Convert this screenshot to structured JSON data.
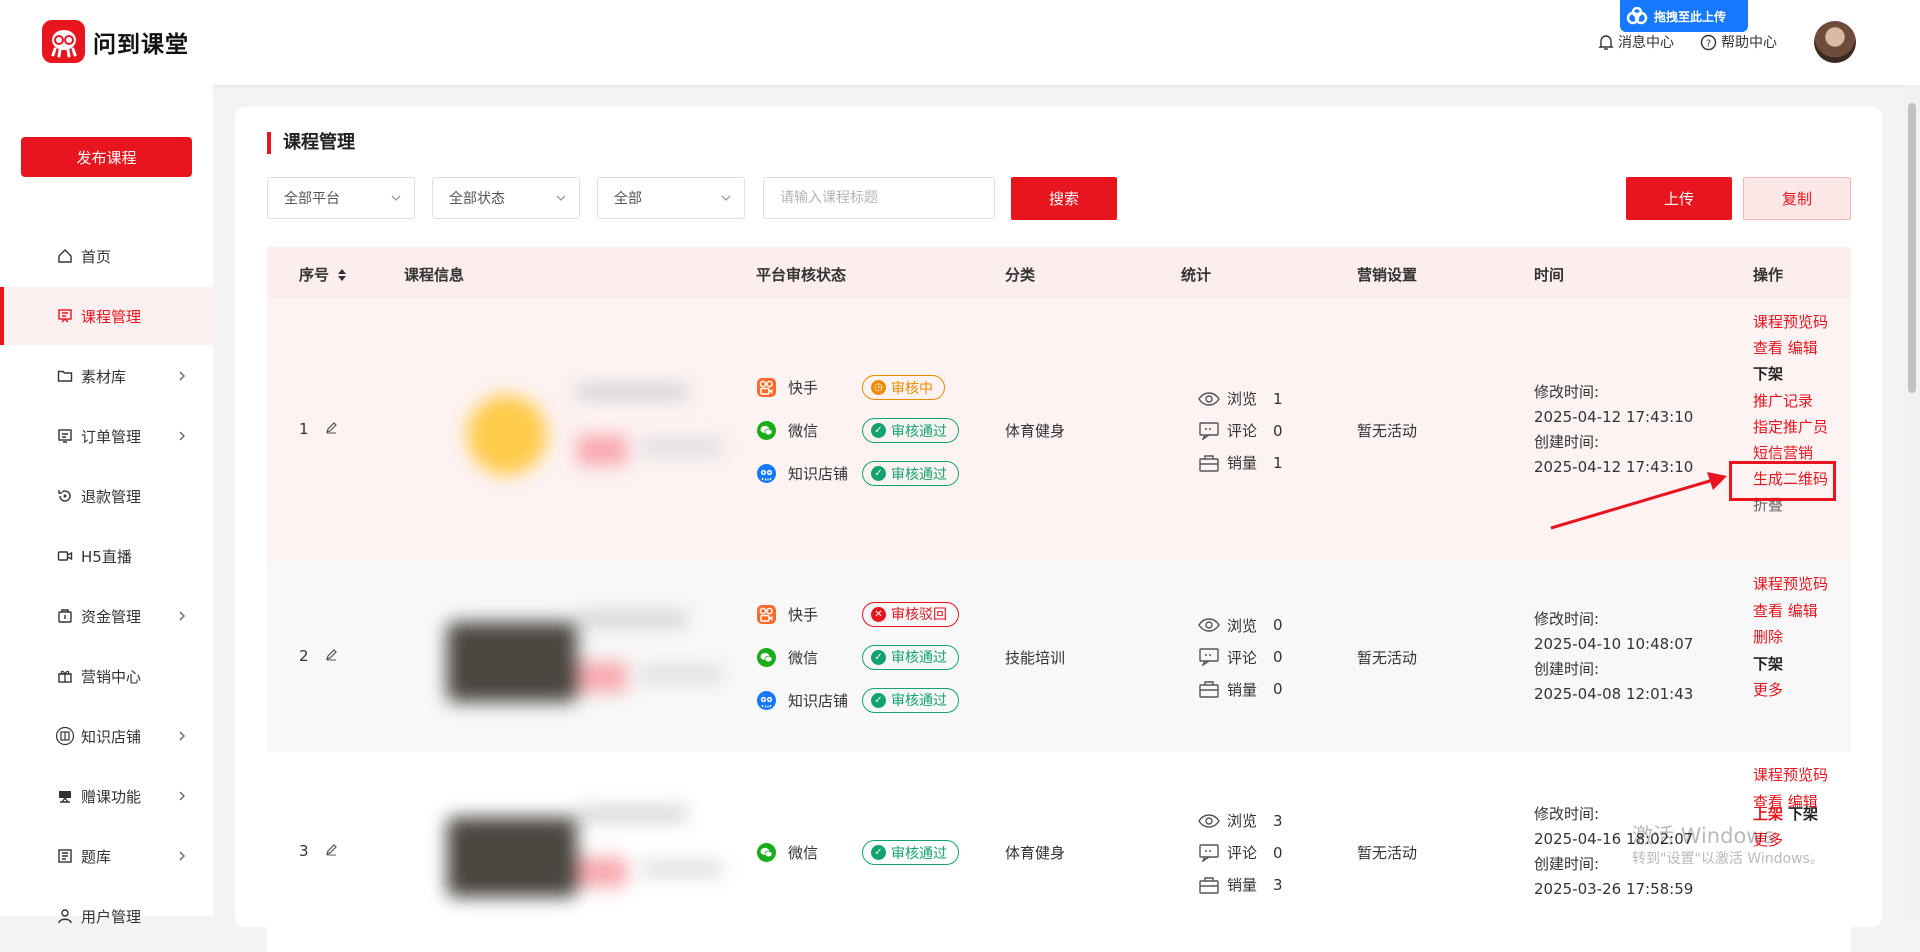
{
  "header": {
    "logo_text": "问到课堂",
    "drop_upload_label": "拖拽至此上传",
    "messages_label": "消息中心",
    "help_label": "帮助中心"
  },
  "sidebar": {
    "publish_label": "发布课程",
    "items": [
      {
        "label": "首页",
        "icon": "home-icon",
        "has_arrow": false
      },
      {
        "label": "课程管理",
        "icon": "course-icon",
        "has_arrow": false,
        "active": true
      },
      {
        "label": "素材库",
        "icon": "folder-icon",
        "has_arrow": true
      },
      {
        "label": "订单管理",
        "icon": "order-icon",
        "has_arrow": true
      },
      {
        "label": "退款管理",
        "icon": "refund-icon",
        "has_arrow": false
      },
      {
        "label": "H5直播",
        "icon": "video-icon",
        "has_arrow": false
      },
      {
        "label": "资金管理",
        "icon": "wallet-icon",
        "has_arrow": true
      },
      {
        "label": "营销中心",
        "icon": "gift-icon",
        "has_arrow": false
      },
      {
        "label": "知识店铺",
        "icon": "shop-icon",
        "has_arrow": true
      },
      {
        "label": "赠课功能",
        "icon": "gift-course-icon",
        "has_arrow": true
      },
      {
        "label": "题库",
        "icon": "question-bank-icon",
        "has_arrow": true
      },
      {
        "label": "用户管理",
        "icon": "user-icon",
        "has_arrow": false
      }
    ]
  },
  "main": {
    "title": "课程管理",
    "filters": {
      "platform": "全部平台",
      "status": "全部状态",
      "category": "全部",
      "search_placeholder": "请输入课程标题",
      "search_label": "搜索",
      "upload_label": "上传",
      "copy_label": "复制"
    },
    "columns": [
      "序号",
      "课程信息",
      "平台审核状态",
      "分类",
      "统计",
      "营销设置",
      "时间",
      "操作"
    ],
    "stat_labels": {
      "views": "浏览",
      "comments": "评论",
      "sales": "销量"
    },
    "time_labels": {
      "modified": "修改时间:",
      "created": "创建时间:"
    },
    "rows": [
      {
        "seq": "1",
        "platforms": [
          {
            "name": "快手",
            "status": "审核中"
          },
          {
            "name": "微信",
            "status": "审核通过"
          },
          {
            "name": "知识店铺",
            "status": "审核通过"
          }
        ],
        "category": "体育健身",
        "views": "1",
        "comments": "0",
        "sales": "1",
        "marketing": "暂无活动",
        "modified": "2025-04-12 17:43:10",
        "created": "2025-04-12 17:43:10",
        "ops": [
          "课程预览码",
          "查看 编辑",
          "下架",
          "推广记录",
          "指定推广员",
          "短信营销",
          "生成二维码",
          "折叠"
        ]
      },
      {
        "seq": "2",
        "platforms": [
          {
            "name": "快手",
            "status": "审核驳回"
          },
          {
            "name": "微信",
            "status": "审核通过"
          },
          {
            "name": "知识店铺",
            "status": "审核通过"
          }
        ],
        "category": "技能培训",
        "views": "0",
        "comments": "0",
        "sales": "0",
        "marketing": "暂无活动",
        "modified": "2025-04-10 10:48:07",
        "created": "2025-04-08 12:01:43",
        "ops": [
          "课程预览码",
          "查看 编辑",
          "删除",
          "下架",
          "更多"
        ]
      },
      {
        "seq": "3",
        "platforms": [
          {
            "name": "微信",
            "status": "审核通过"
          }
        ],
        "category": "体育健身",
        "views": "3",
        "comments": "0",
        "sales": "3",
        "marketing": "暂无活动",
        "modified": "2025-04-16 18:02:07",
        "created": "2025-03-26 17:58:59",
        "ops": [
          "课程预览码",
          "查看 编辑",
          "上架",
          "下架",
          "更多"
        ]
      }
    ]
  },
  "watermark": {
    "line1": "激活 Windows",
    "line2": "转到\"设置\"以激活 Windows。"
  },
  "colors": {
    "accent": "#e8141e",
    "approved": "#14a36e",
    "pending": "#f08a00"
  }
}
